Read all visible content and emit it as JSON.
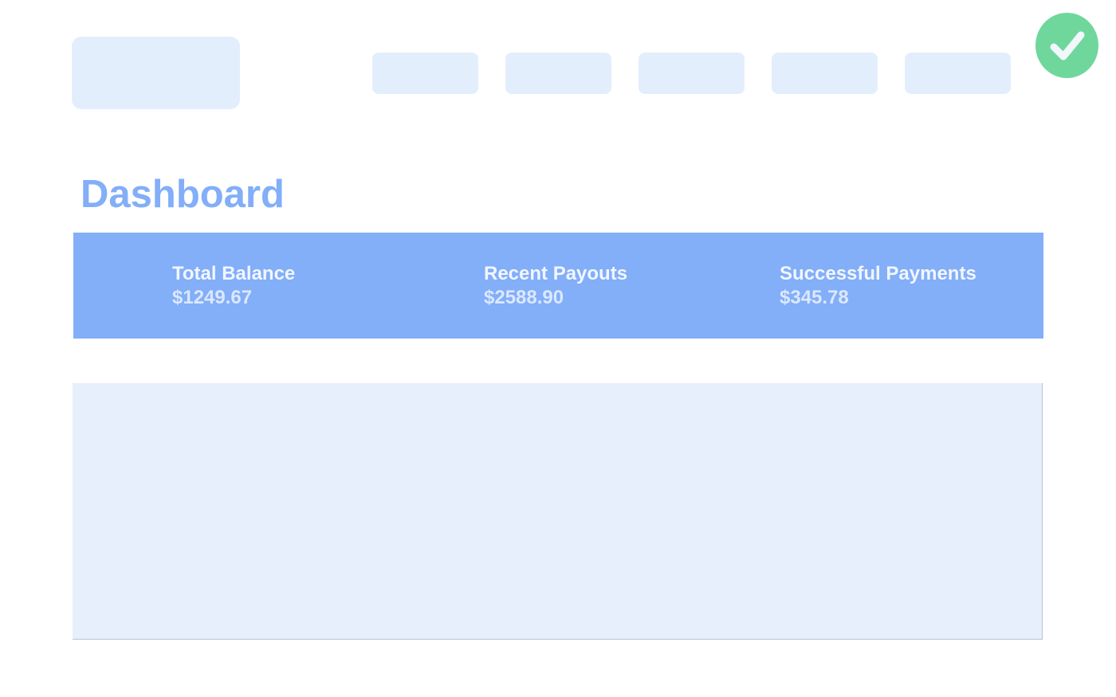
{
  "header": {
    "nav_count": 5,
    "status_icon": "check-icon"
  },
  "colors": {
    "accent": "#83aef8",
    "placeholder": "#e3eefd",
    "panel": "#e8effc",
    "success": "#6fd79c"
  },
  "main": {
    "title": "Dashboard",
    "stats": [
      {
        "label": "Total Balance",
        "value": "$1249.67"
      },
      {
        "label": "Recent Payouts",
        "value": "$2588.90"
      },
      {
        "label": "Successful Payments",
        "value": "$345.78"
      }
    ]
  }
}
